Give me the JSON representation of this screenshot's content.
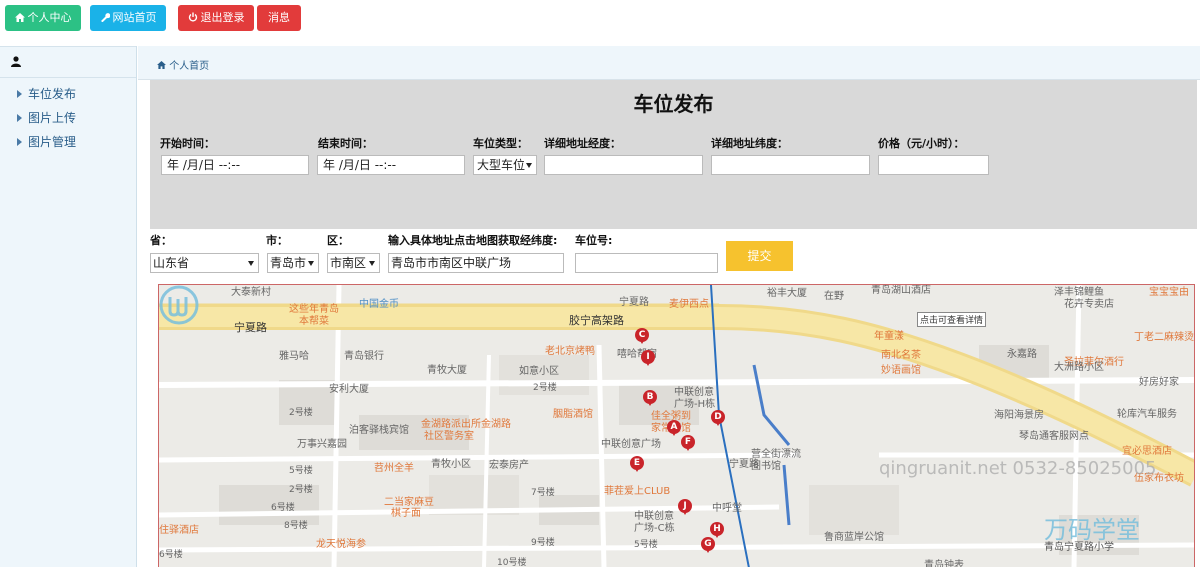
{
  "topnav": {
    "personal_center": "个人中心",
    "home_site": "网站首页",
    "logout": "退出登录",
    "messages": "消息",
    "colors": {
      "green": "#2cc185",
      "teal": "#1ab2e8",
      "red": "#e23b3b"
    }
  },
  "sidebar": {
    "user_icon": "user-icon",
    "items": [
      {
        "label": "车位发布"
      },
      {
        "label": "图片上传"
      },
      {
        "label": "图片管理"
      }
    ]
  },
  "breadcrumb": {
    "home_icon": "home-icon",
    "label": "个人首页"
  },
  "form": {
    "title": "车位发布",
    "start_time_label": "开始时间：",
    "start_time_value": "年 /月/日 --:--",
    "end_time_label": "结束时间：",
    "end_time_value": "年 /月/日 --:--",
    "space_type_label": "车位类型：",
    "space_type_value": "大型车位",
    "longitude_label": "详细地址经度：",
    "longitude_value": "",
    "latitude_label": "详细地址纬度：",
    "latitude_value": "",
    "price_label": "价格（元/小时）：",
    "price_value": "",
    "province_label": "省：",
    "province_value": "山东省",
    "city_label": "市：",
    "city_value": "青岛市",
    "district_label": "区：",
    "district_value": "市南区",
    "address_label": "输入具体地址点击地图获取经纬度:",
    "address_value": "青岛市市南区中联广场",
    "space_no_label": "车位号:",
    "space_no_value": "",
    "submit_label": "提交",
    "submit_color": "#f6c22e"
  },
  "map": {
    "tooltip": "点击可查看详情",
    "watermark": "qingruanit.net 0532-85025005",
    "logo_name": "万码学堂",
    "logo_sub": "青岛宁夏路小学",
    "labels": [
      "大泰新村",
      "中国金币",
      "这些年青岛",
      "本帮菜",
      "宁夏路",
      "胶宁高架路",
      "宁夏路",
      "麦伊西点",
      "裕丰大厦",
      "在野",
      "青岛湖山酒店",
      "泽丰锦鲤鱼",
      "花卉专卖店",
      "宝宝宝由",
      "年童漾",
      "南北名茶",
      "妙语画馆",
      "丁老二麻辣烫",
      "圣拉菲尔酒行",
      "好房好家",
      "大洲路小区",
      "海阳海景房",
      "永嘉路",
      "轮库汽车服务",
      "琴岛通客服网点",
      "宜必思酒店",
      "伍家布衣坊",
      "雅马哈",
      "青岛银行",
      "青牧大厦",
      "安利大厦",
      "如意小区",
      "老北京烤鸭",
      "嘻哈帮宿",
      "中联创意",
      "广场-H栋",
      "佳全粥到",
      "家常菜馆",
      "胭脂酒馆",
      "泊客驿栈宾馆",
      "金湖路派出所金湖路",
      "社区警务室",
      "万事兴嘉园",
      "中联创意广场",
      "青牧小区",
      "宏泰房产",
      "宁夏路",
      "营全街漂流",
      "图书馆",
      "菲茬爱上CLUB",
      "苕州全羊",
      "二当家麻豆",
      "棋子面",
      "中联创意",
      "广场-C栋",
      "中呼堂",
      "龙天悦海参",
      "住驿酒店",
      "鲁商蓝岸公馆",
      "青岛钟表",
      "5号楼",
      "6号楼",
      "7号楼",
      "8号楼",
      "9号楼",
      "10号楼",
      "2号楼",
      "2号楼",
      "2号楼",
      "5号楼",
      "6号楼"
    ],
    "pins": [
      "C",
      "I",
      "B",
      "D",
      "A",
      "F",
      "E",
      "J",
      "H",
      "G"
    ]
  }
}
